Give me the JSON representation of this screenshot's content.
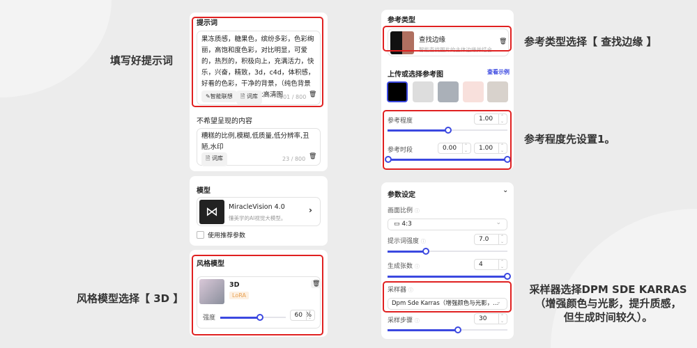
{
  "annotations": {
    "prompt": "填写好提示词",
    "style": "风格模型选择【 3D 】",
    "ref_type": "参考类型选择【 查找边缘 】",
    "ref_degree": "参考程度先设置1。",
    "sampler_l1": "采样器选择DPM SDE KARRAS",
    "sampler_l2": "（增强颜色与光影，提升质感，",
    "sampler_l3": "但生成时间较久）。"
  },
  "left": {
    "prompt": {
      "title": "提示词",
      "text": "果冻质感，糖果色，缤纷多彩，色彩绚丽，高饱和度色彩，对比明显，可爱的，热烈的，积极向上，充满活力，快乐，兴奋，精致，3d，c4d，体积感，好看的色彩，干净的背景，（纯色背景1:4），细节丰富，4k高清图",
      "smart": "✎智能联想",
      "lib": "词库",
      "count": "101 / 800"
    },
    "negative": {
      "title": "不希望呈现的内容",
      "text": "糟糕的比例,模糊,低质量,低分辨率,丑陋,水印",
      "lib": "词库",
      "count": "23 / 800"
    },
    "model": {
      "title": "模型",
      "name": "MiracleVision 4.0",
      "desc": "懂美学的AI视觉大模型。",
      "recommend": "使用推荐参数"
    },
    "style": {
      "title": "风格模型",
      "name": "3D",
      "tag": "LoRA",
      "strength_label": "强度",
      "strength": "60",
      "unit": "%",
      "strength_value": 0.6
    }
  },
  "right": {
    "ref_type": {
      "title": "参考类型",
      "name": "查找边缘",
      "desc": "智能查找图片的主体边缘并结合..."
    },
    "upload": {
      "title": "上传或选择参考图",
      "example": "查看示例"
    },
    "degree": {
      "label": "参考程度",
      "value": "1.00",
      "fraction": 0.45
    },
    "period": {
      "label": "参考时段",
      "start": "0.00",
      "end": "1.00"
    },
    "params": {
      "title": "参数设定",
      "ratio_label": "画面比例",
      "ratio": "4:3",
      "cfg_label": "提示词强度",
      "cfg": "7.0",
      "count_label": "生成张数",
      "count": "4",
      "sampler_label": "采样器",
      "sampler": "Dpm Sde Karras（增强颜色与光影，...",
      "steps_label": "采样步骤",
      "steps": "30"
    }
  }
}
